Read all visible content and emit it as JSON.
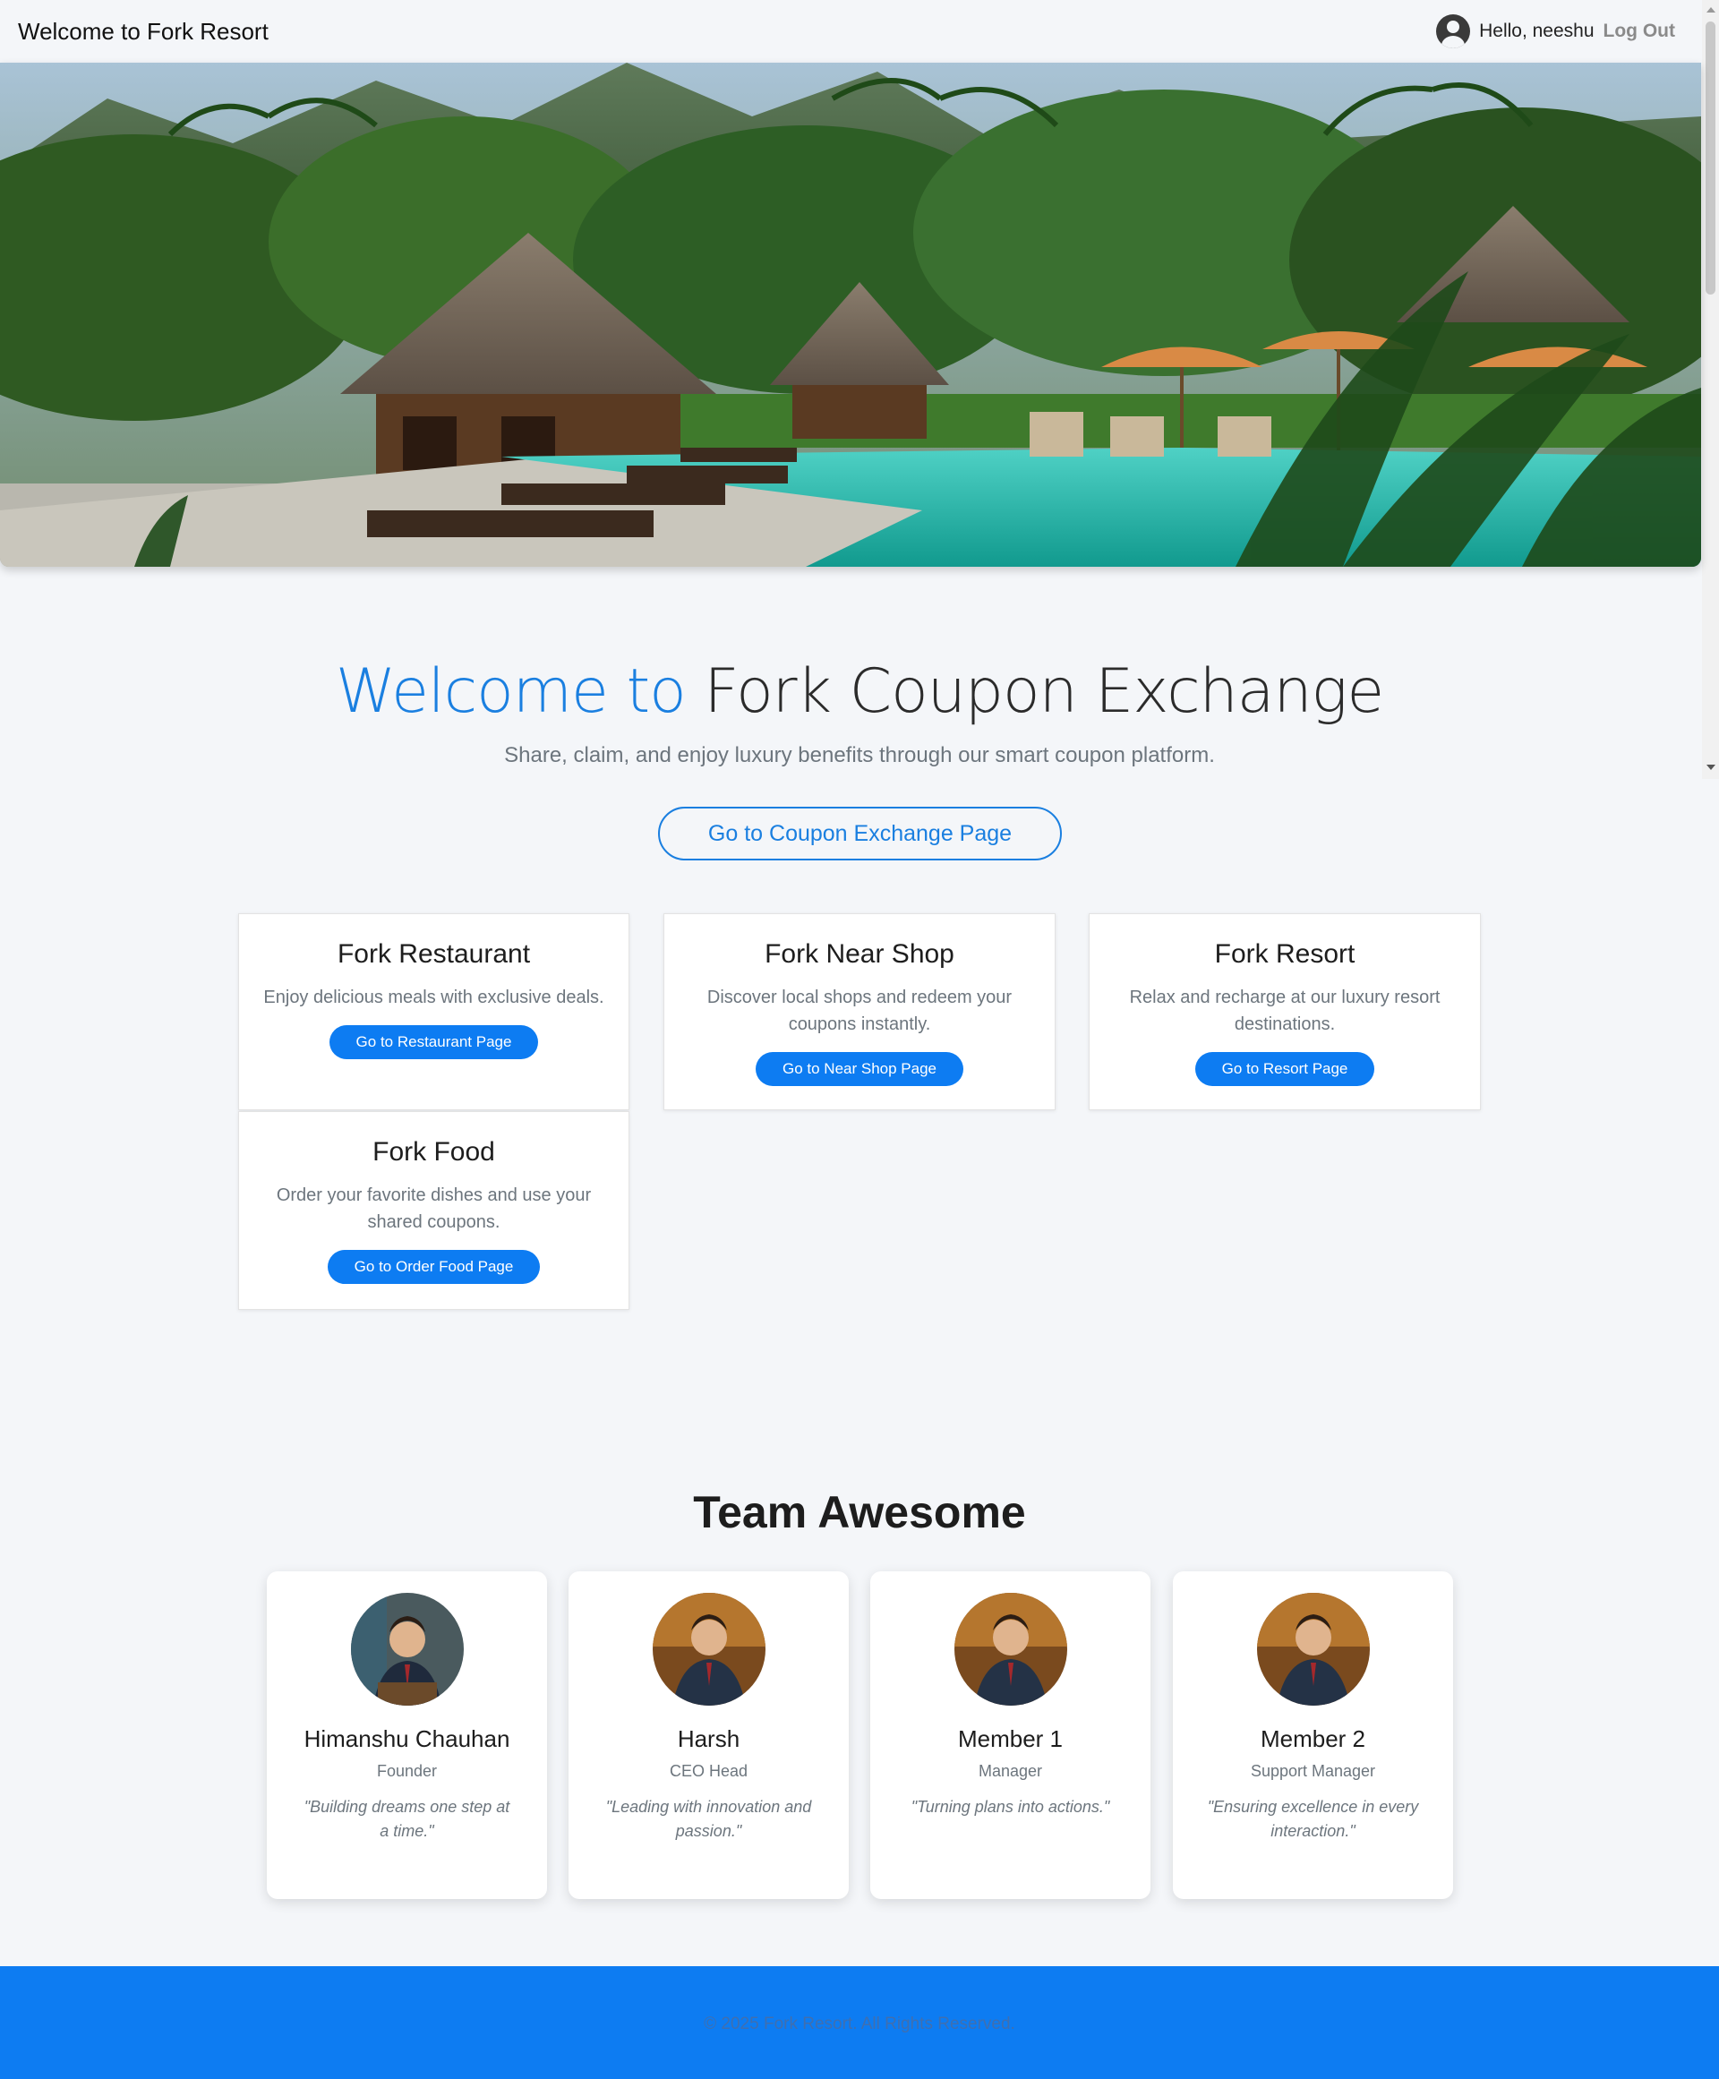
{
  "navbar": {
    "brand": "Welcome to Fork Resort",
    "greeting": "Hello, neeshu",
    "logout_label": "Log Out"
  },
  "hero": {
    "image": "tropical-resort-pool-photo"
  },
  "welcome": {
    "title_highlight": "Welcome to",
    "title_rest": "Fork Coupon Exchange",
    "subtitle": "Share, claim, and enjoy luxury benefits through our smart coupon platform.",
    "cta_label": "Go to Coupon Exchange Page"
  },
  "services": [
    {
      "title": "Fork Restaurant",
      "description": "Enjoy delicious meals with exclusive deals.",
      "button": "Go to Restaurant Page"
    },
    {
      "title": "Fork Near Shop",
      "description": "Discover local shops and redeem your coupons instantly.",
      "button": "Go to Near Shop Page"
    },
    {
      "title": "Fork Resort",
      "description": "Relax and recharge at our luxury resort destinations.",
      "button": "Go to Resort Page"
    },
    {
      "title": "Fork Food",
      "description": "Order your favorite dishes and use your shared coupons.",
      "button": "Go to Order Food Page"
    }
  ],
  "team": {
    "title": "Team Awesome",
    "members": [
      {
        "name": "Himanshu Chauhan",
        "role": "Founder",
        "quote": "\"Building dreams one step at a time.\""
      },
      {
        "name": "Harsh",
        "role": "CEO Head",
        "quote": "\"Leading with innovation and passion.\""
      },
      {
        "name": "Member 1",
        "role": "Manager",
        "quote": "\"Turning plans into actions.\""
      },
      {
        "name": "Member 2",
        "role": "Support Manager",
        "quote": "\"Ensuring excellence in every interaction.\""
      }
    ]
  },
  "footer": {
    "text": "© 2025 Fork Resort. All Rights Reserved."
  },
  "colors": {
    "primary": "#0d7cf2",
    "accent_text": "#1a7fe0",
    "background": "#f4f6f9"
  }
}
